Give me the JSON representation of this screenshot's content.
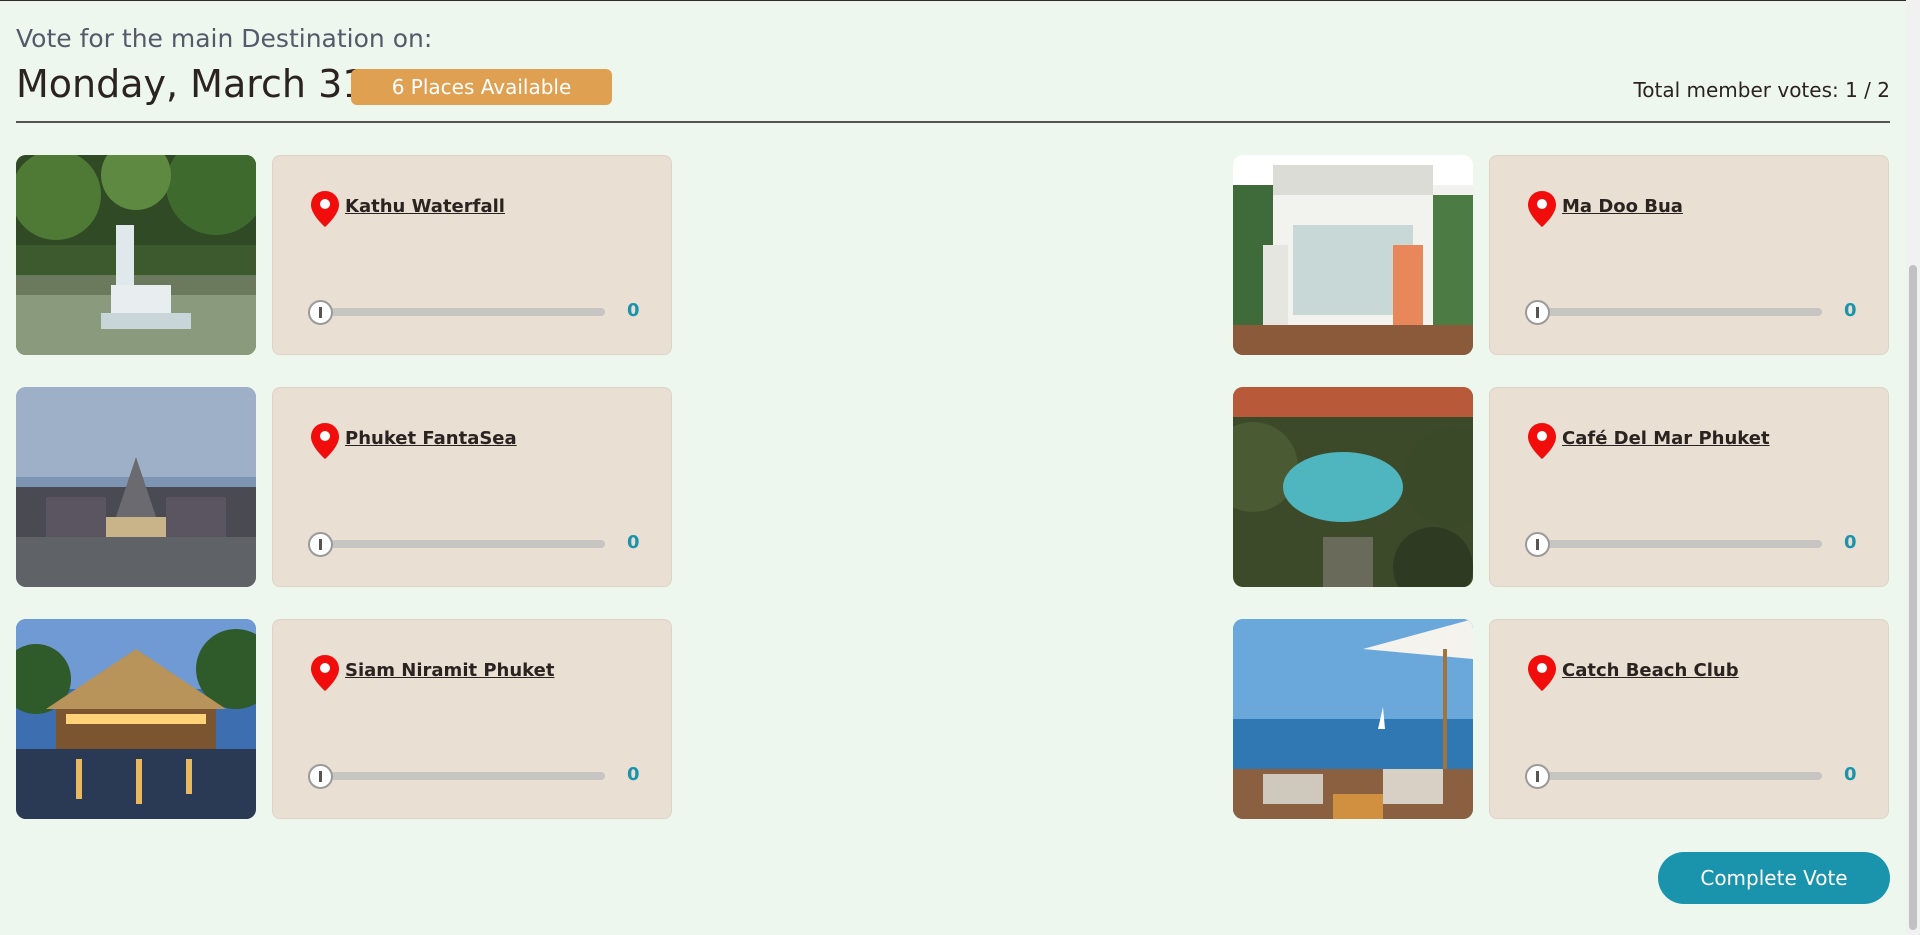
{
  "header": {
    "subtitle": "Vote for the main Destination on:",
    "date": "Monday, March 31",
    "places_badge": "6 Places Available",
    "total_votes": "Total member votes: 1 / 2"
  },
  "places": [
    {
      "name": "Kathu Waterfall",
      "votes": "0",
      "vote_fraction": 0
    },
    {
      "name": "Ma Doo Bua",
      "votes": "0",
      "vote_fraction": 0
    },
    {
      "name": "Phuket FantaSea",
      "votes": "0",
      "vote_fraction": 0
    },
    {
      "name": "Café Del Mar Phuket",
      "votes": "0",
      "vote_fraction": 0
    },
    {
      "name": "Siam Niramit Phuket",
      "votes": "0",
      "vote_fraction": 0
    },
    {
      "name": "Catch Beach Club",
      "votes": "0",
      "vote_fraction": 0
    }
  ],
  "actions": {
    "complete_label": "Complete Vote"
  },
  "colors": {
    "background": "#edf7ee",
    "card": "#e9dfd3",
    "badge": "#e0a052",
    "accent": "#1a93ad",
    "pin": "#f20d0d"
  }
}
